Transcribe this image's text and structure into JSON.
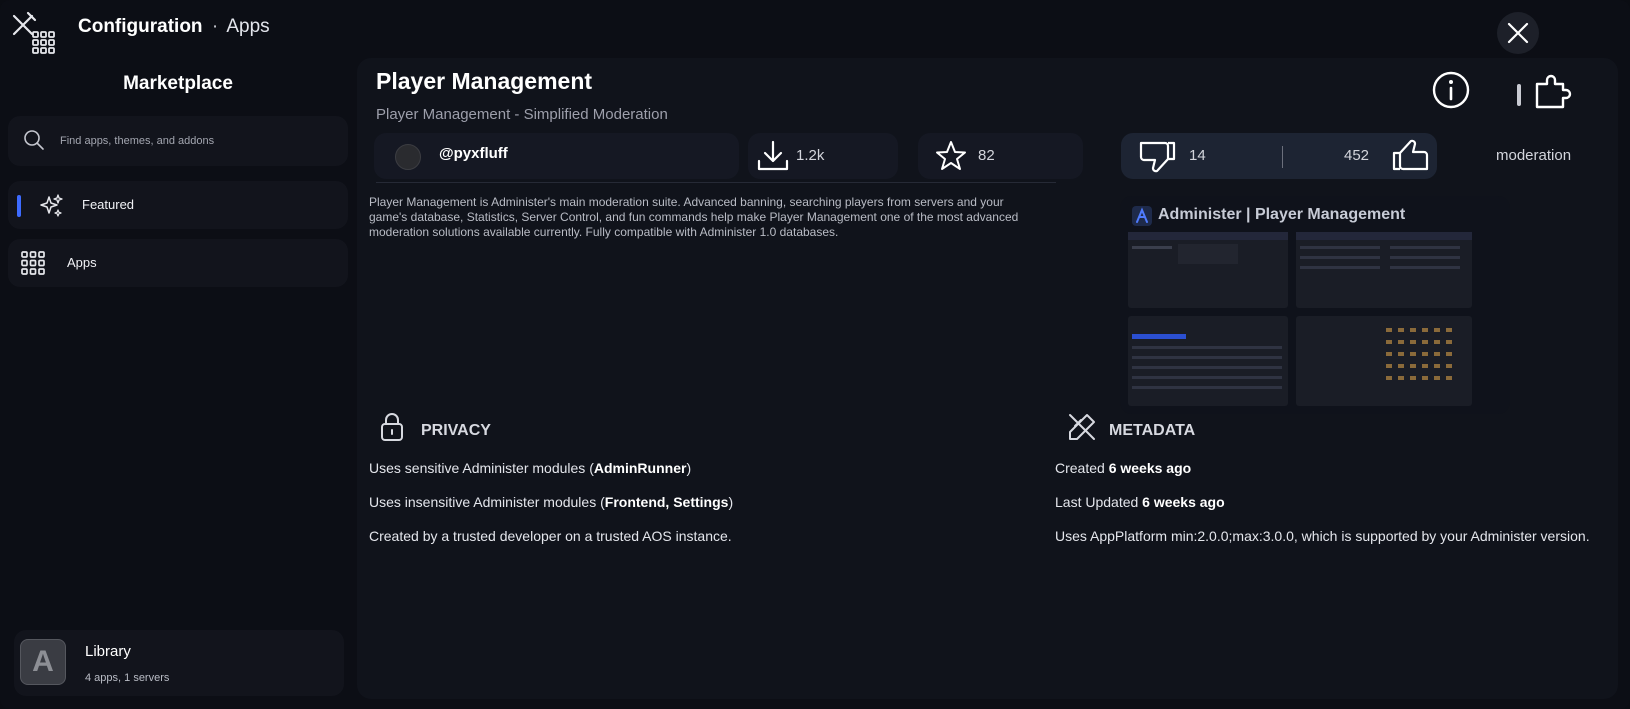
{
  "header": {
    "app_name": "Configuration",
    "separator": "·",
    "section": "Apps"
  },
  "sidebar": {
    "title": "Marketplace",
    "search_placeholder": "Find apps, themes, and addons",
    "nav_items": [
      {
        "label": "Featured",
        "icon": "sparkles-icon",
        "active": true
      },
      {
        "label": "Apps",
        "icon": "grid-icon",
        "active": false
      }
    ],
    "library": {
      "title": "Library",
      "subtitle": "4 apps, 1 servers",
      "avatar_letter": "A"
    }
  },
  "app": {
    "title": "Player Management",
    "subtitle": "Player Management - Simplified Moderation",
    "author": "@pyxfluff",
    "downloads": "1.2k",
    "stars": "82",
    "dislikes": "14",
    "likes": "452",
    "tag": "moderation",
    "description": "Player Management is Administer's main moderation suite. Advanced banning, searching players from servers and your game's database, Statistics, Server Control, and fun commands help make Player Management one of the most advanced moderation solutions available currently. Fully compatible with Administer 1.0 databases.",
    "preview_title": "Administer | Player Management"
  },
  "privacy": {
    "heading": "PRIVACY",
    "sensitive_prefix": "Uses sensitive Administer modules (",
    "sensitive_modules": "AdminRunner",
    "sensitive_suffix": ")",
    "insensitive_prefix": "Uses insensitive Administer modules (",
    "insensitive_modules": "Frontend, Settings",
    "insensitive_suffix": ")",
    "trust": "Created by a trusted developer on a trusted AOS instance."
  },
  "metadata": {
    "heading": "METADATA",
    "created_prefix": "Created ",
    "created_value": "6 weeks ago",
    "updated_prefix": "Last Updated ",
    "updated_value": "6 weeks ago",
    "platform": "Uses AppPlatform min:2.0.0;max:3.0.0, which is supported by your Administer version."
  },
  "colors": {
    "accent": "#3d6bff",
    "background": "#0c0e15",
    "panel": "#10131b"
  }
}
